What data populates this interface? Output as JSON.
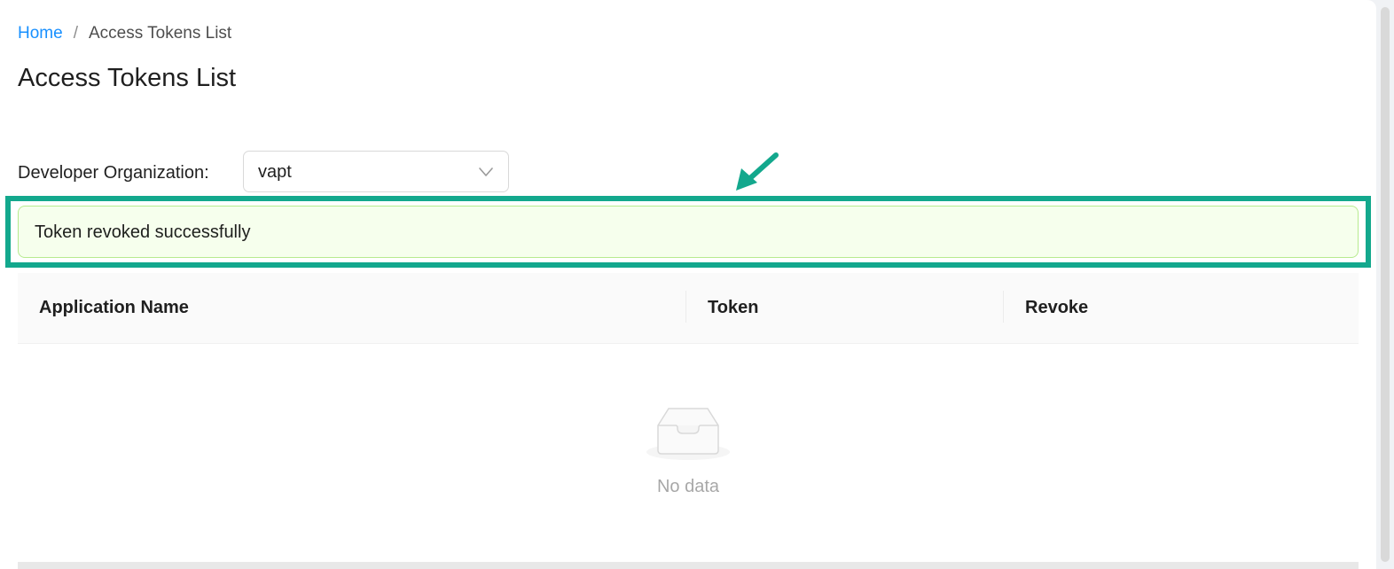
{
  "breadcrumb": {
    "home": "Home",
    "separator": "/",
    "current": "Access Tokens List"
  },
  "page": {
    "title": "Access Tokens List"
  },
  "filter": {
    "label": "Developer Organization:",
    "selected": "vapt",
    "icon": "chevron-down-icon"
  },
  "alert": {
    "type": "success",
    "message": "Token revoked successfully"
  },
  "annotation": {
    "color": "#13a88d",
    "icon": "arrow-pointer-icon"
  },
  "table": {
    "columns": [
      "Application Name",
      "Token",
      "Revoke"
    ],
    "rows": [],
    "empty_text": "No data",
    "empty_icon": "empty-inbox-icon"
  },
  "colors": {
    "link": "#1890ff",
    "alert_bg": "#f6ffed",
    "alert_border": "#b7eb8f",
    "annotation": "#13a88d"
  }
}
